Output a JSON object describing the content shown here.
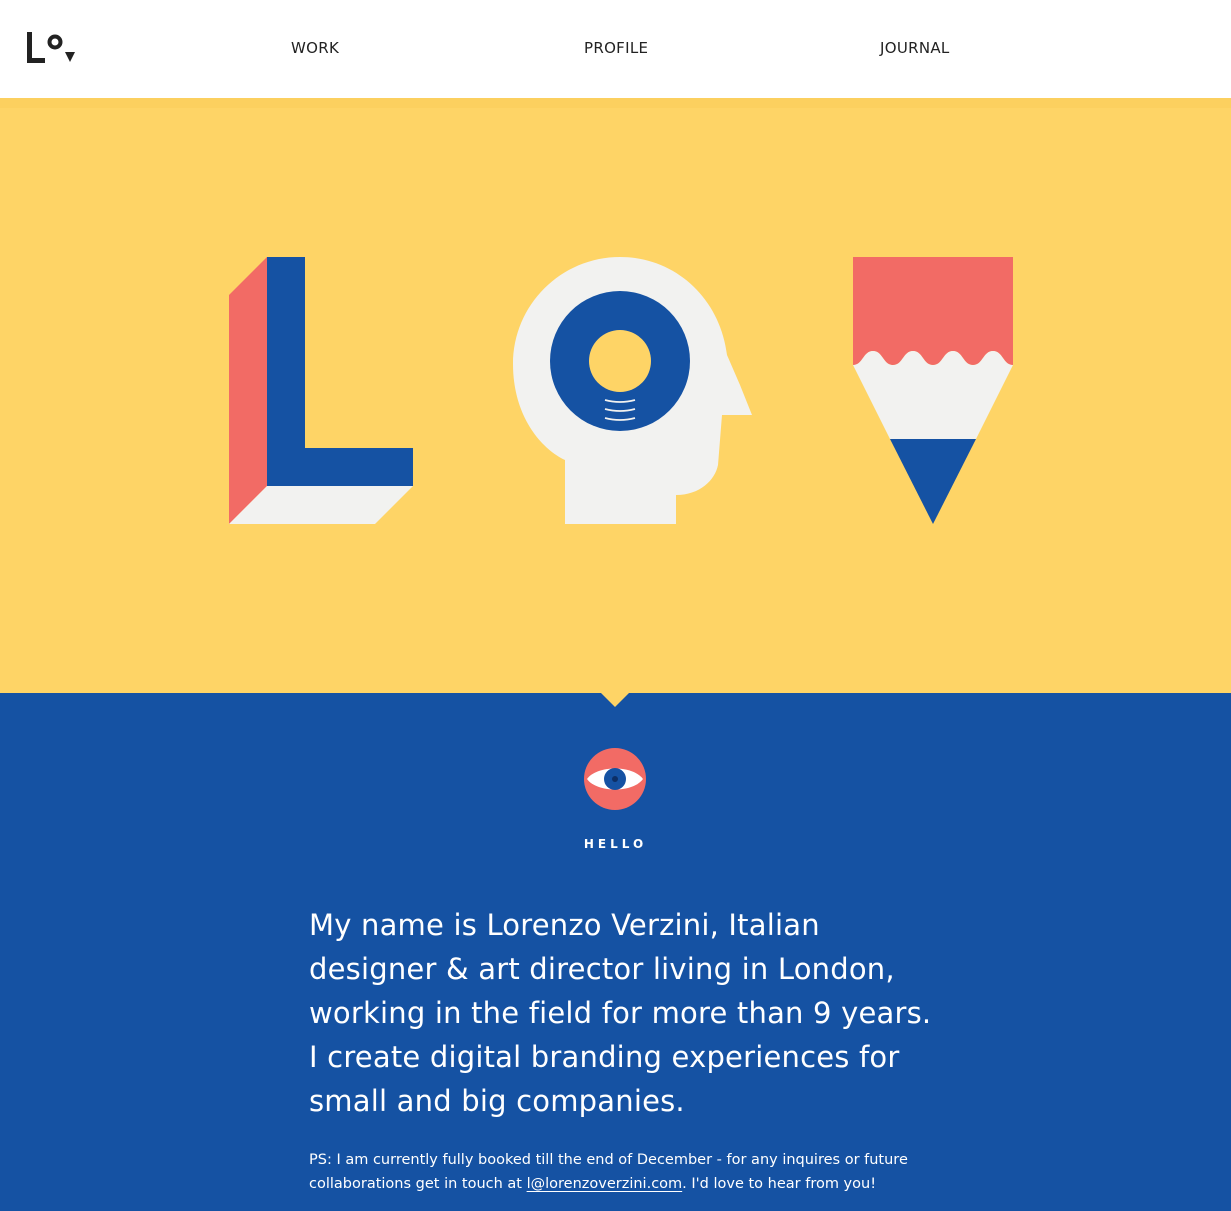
{
  "header": {
    "logo_alt": "Lorenzo Verzini logo",
    "nav": {
      "work": "WORK",
      "profile": "PROFILE",
      "journal": "JOURNAL"
    }
  },
  "hero": {
    "icons": [
      "letter-l-3d-icon",
      "head-with-lightbulb-icon",
      "pencil-icon"
    ]
  },
  "intro": {
    "icon": "eye-icon",
    "heading": "HELLO",
    "bio": "My name is Lorenzo Verzini, Italian designer & art director living in London, working in the field for more than 9 years. I create digital branding experiences for small and big companies.",
    "ps_prefix": "PS: I am currently fully booked till the end of December - for any inquires or future collaborations get in touch at ",
    "email": "l@lorenzoverzini.com",
    "ps_suffix": ". I'd love to hear from you!"
  },
  "colors": {
    "yellow": "#fed466",
    "blue": "#1552a3",
    "coral": "#f26b65",
    "off_white": "#f2f2f0",
    "dark": "#222222"
  }
}
